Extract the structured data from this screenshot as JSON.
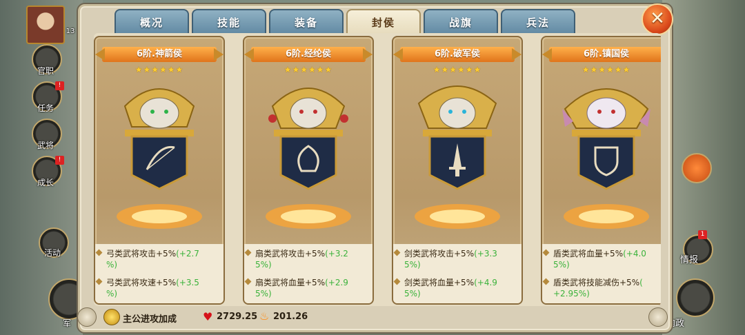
{
  "tabs": [
    {
      "label": "概况",
      "active": false
    },
    {
      "label": "技能",
      "active": false
    },
    {
      "label": "装备",
      "active": false
    },
    {
      "label": "封侯",
      "active": true
    },
    {
      "label": "战旗",
      "active": false
    },
    {
      "label": "兵法",
      "active": false
    }
  ],
  "close_label": "✕",
  "side_menu": {
    "level_partial": "13",
    "items": [
      {
        "label": "官职",
        "badge": ""
      },
      {
        "label": "任务",
        "badge": "!"
      },
      {
        "label": "武将",
        "badge": ""
      },
      {
        "label": "成长",
        "badge": "!"
      },
      {
        "label": "活动",
        "badge": ""
      },
      {
        "label": "军",
        "badge": ""
      }
    ]
  },
  "right_menu": {
    "intel_label": "情报",
    "intel_badge": "1",
    "domestic_label": "内政"
  },
  "cards": [
    {
      "title": "6阶.神箭侯",
      "stars": "★★★★★★",
      "star_count": 6,
      "banner_icon": "bow-icon",
      "attrs": [
        {
          "text": "弓类武将攻击+5%",
          "bonus_a": "(+2.7",
          "bonus_b": "%)"
        },
        {
          "text": "弓类武将攻速+5%",
          "bonus_a": "(+3.5",
          "bonus_b": "%)"
        }
      ]
    },
    {
      "title": "6阶.经纶侯",
      "stars": "★★★★★★",
      "star_count": 6,
      "banner_icon": "fan-icon",
      "attrs": [
        {
          "text": "扇类武将攻击+5%",
          "bonus_a": "(+3.2",
          "bonus_b": "5%)"
        },
        {
          "text": "扇类武将血量+5%",
          "bonus_a": "(+2.9",
          "bonus_b": "5%)"
        }
      ]
    },
    {
      "title": "6阶.破军侯",
      "stars": "★★★★★★",
      "star_count": 6,
      "banner_icon": "sword-icon",
      "attrs": [
        {
          "text": "剑类武将攻击+5%",
          "bonus_a": "(+3.3",
          "bonus_b": "5%)"
        },
        {
          "text": "剑类武将血量+5%",
          "bonus_a": "(+4.9",
          "bonus_b": "5%)"
        }
      ]
    },
    {
      "title": "6阶.镇国侯",
      "stars": "★★★★★★",
      "star_count": 6,
      "banner_icon": "shield-icon",
      "attrs": [
        {
          "text": "盾类武将血量+5%",
          "bonus_a": "(+4.0",
          "bonus_b": "5%)"
        },
        {
          "text": "盾类武将技能减伤+5%",
          "bonus_a": "(",
          "bonus_b": "+2.95%)"
        }
      ]
    }
  ],
  "footer": {
    "bonus_label": "主公进攻加成",
    "health_value": "2729.25",
    "attack_value": "201.26"
  },
  "colors": {
    "bonus_green": "#3bb23b",
    "tab_blue": "#6f95ad",
    "title_orange": "#f0922e"
  }
}
